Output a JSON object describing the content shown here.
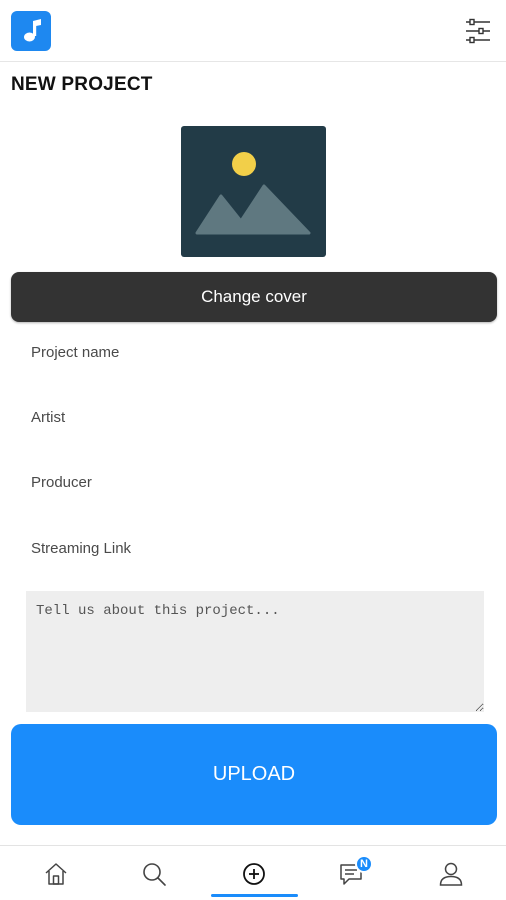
{
  "header": {
    "logo_icon": "music-note-icon",
    "filter_icon": "sliders-icon",
    "accent_color": "#1e88f0"
  },
  "page": {
    "title": "NEW PROJECT"
  },
  "cover": {
    "icon": "image-placeholder-icon",
    "button_label": "Change cover"
  },
  "form": {
    "project_name_placeholder": "Project name",
    "artist_placeholder": "Artist",
    "producer_placeholder": "Producer",
    "streaming_link_placeholder": "Streaming Link",
    "description_placeholder": "Tell us about this project..."
  },
  "upload": {
    "label": "UPLOAD",
    "color": "#1a8cfb"
  },
  "tabbar": {
    "items": [
      {
        "icon": "home-icon"
      },
      {
        "icon": "search-icon"
      },
      {
        "icon": "add-circle-icon",
        "active": true
      },
      {
        "icon": "chat-icon",
        "badge": "N"
      },
      {
        "icon": "profile-icon"
      }
    ]
  }
}
